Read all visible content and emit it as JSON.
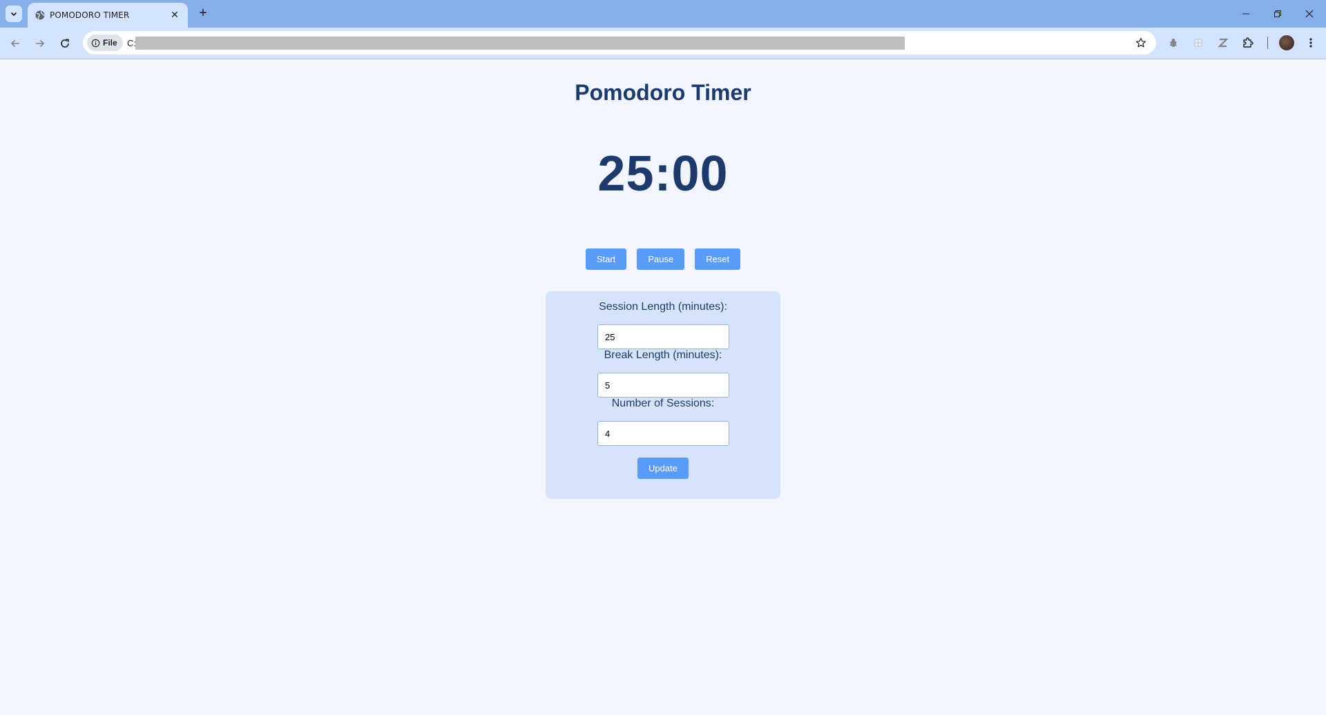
{
  "browser": {
    "tab_title": "POMODORO TIMER",
    "new_tab_symbol": "+",
    "omnibox": {
      "scheme_label": "File",
      "url_prefix": "C:"
    }
  },
  "app": {
    "title": "Pomodoro Timer",
    "timer": "25:00",
    "controls": {
      "start": "Start",
      "pause": "Pause",
      "reset": "Reset"
    },
    "settings": {
      "session_label": "Session Length (minutes):",
      "session_value": "25",
      "break_label": "Break Length (minutes):",
      "break_value": "5",
      "sessions_label": "Number of Sessions:",
      "sessions_value": "4",
      "update": "Update"
    }
  },
  "colors": {
    "accent": "#5b9bf8",
    "heading": "#1e3a6b",
    "card_bg": "#d5e4fb",
    "page_bg": "#f1f5fd"
  }
}
